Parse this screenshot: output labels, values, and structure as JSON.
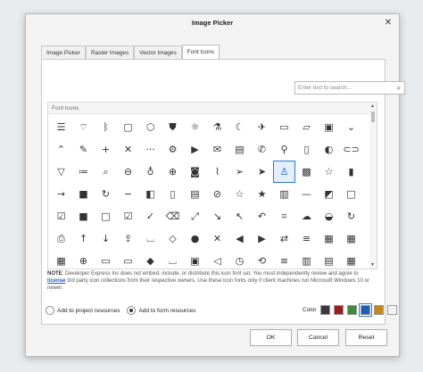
{
  "dialog": {
    "title": "Image Picker",
    "close_glyph": "✕"
  },
  "tabs": [
    {
      "label": "Image Picker",
      "active": false
    },
    {
      "label": "Raster Images",
      "active": false
    },
    {
      "label": "Vector Images",
      "active": false
    },
    {
      "label": "Font Icons",
      "active": true
    }
  ],
  "search": {
    "placeholder": "Enter text to search...",
    "icon": "search-icon"
  },
  "grid": {
    "group_header": "Font Icons",
    "selected_index": 38,
    "icons": [
      {
        "name": "hamburger-icon",
        "glyph": "☰"
      },
      {
        "name": "wifi-icon",
        "glyph": "⌔"
      },
      {
        "name": "bluetooth-icon",
        "glyph": "ᛒ"
      },
      {
        "name": "chat-icon",
        "glyph": "▢"
      },
      {
        "name": "cube-icon",
        "glyph": "⬡"
      },
      {
        "name": "shield-icon",
        "glyph": "⛊"
      },
      {
        "name": "sun-icon",
        "glyph": "☼"
      },
      {
        "name": "flask-icon",
        "glyph": "⚗"
      },
      {
        "name": "moon-icon",
        "glyph": "☾"
      },
      {
        "name": "airplane-icon",
        "glyph": "✈"
      },
      {
        "name": "keyboard-icon",
        "glyph": "▭"
      },
      {
        "name": "note-icon",
        "glyph": "▱"
      },
      {
        "name": "picture-icon",
        "glyph": "▣"
      },
      {
        "name": "chevron-down-icon",
        "glyph": "⌄"
      },
      {
        "name": "chevron-up-icon",
        "glyph": "⌃"
      },
      {
        "name": "pencil-icon",
        "glyph": "✎"
      },
      {
        "name": "plus-icon",
        "glyph": "+"
      },
      {
        "name": "close-icon",
        "glyph": "✕"
      },
      {
        "name": "more-icon",
        "glyph": "···"
      },
      {
        "name": "gear-icon",
        "glyph": "⚙"
      },
      {
        "name": "video-icon",
        "glyph": "▶"
      },
      {
        "name": "mail-icon",
        "glyph": "✉"
      },
      {
        "name": "save-icon",
        "glyph": "▤"
      },
      {
        "name": "phone-icon",
        "glyph": "✆"
      },
      {
        "name": "pin-icon",
        "glyph": "⚲"
      },
      {
        "name": "battery-icon",
        "glyph": "▯"
      },
      {
        "name": "toggle-icon",
        "glyph": "◐"
      },
      {
        "name": "link-icon",
        "glyph": "⊂⊃"
      },
      {
        "name": "filter-icon",
        "glyph": "▽"
      },
      {
        "name": "list-icon",
        "glyph": "≔"
      },
      {
        "name": "search-icon",
        "glyph": "⌕"
      },
      {
        "name": "zoom-out-icon",
        "glyph": "⊖"
      },
      {
        "name": "mic-icon",
        "glyph": "♁"
      },
      {
        "name": "zoom-in-icon",
        "glyph": "⊕"
      },
      {
        "name": "camera-icon",
        "glyph": "◙"
      },
      {
        "name": "paperclip-icon",
        "glyph": "⌇"
      },
      {
        "name": "send-icon",
        "glyph": "➢"
      },
      {
        "name": "send-filled-icon",
        "glyph": "➤"
      },
      {
        "name": "walk-icon",
        "glyph": "♙"
      },
      {
        "name": "image-icon",
        "glyph": "▩"
      },
      {
        "name": "star-note-icon",
        "glyph": "☆"
      },
      {
        "name": "document-icon",
        "glyph": "▮"
      },
      {
        "name": "arrow-right-icon",
        "glyph": "→"
      },
      {
        "name": "square-fill-icon",
        "glyph": "■"
      },
      {
        "name": "refresh-icon",
        "glyph": "↻"
      },
      {
        "name": "minus-icon",
        "glyph": "−"
      },
      {
        "name": "square-split-icon",
        "glyph": "◧"
      },
      {
        "name": "file-icon",
        "glyph": "▯"
      },
      {
        "name": "file-text-icon",
        "glyph": "▤"
      },
      {
        "name": "ban-icon",
        "glyph": "⊘"
      },
      {
        "name": "star-icon",
        "glyph": "☆"
      },
      {
        "name": "star-filled-icon",
        "glyph": "★"
      },
      {
        "name": "book-icon",
        "glyph": "▥"
      },
      {
        "name": "dash-icon",
        "glyph": "—"
      },
      {
        "name": "square-half-icon",
        "glyph": "◩"
      },
      {
        "name": "square-outline-icon",
        "glyph": "□"
      },
      {
        "name": "checkbox-icon",
        "glyph": "☑"
      },
      {
        "name": "square-dark-icon",
        "glyph": "■"
      },
      {
        "name": "square-outline2-icon",
        "glyph": "□"
      },
      {
        "name": "checkbox-filled-icon",
        "glyph": "☑"
      },
      {
        "name": "check-icon",
        "glyph": "✓"
      },
      {
        "name": "trash-icon",
        "glyph": "⌫"
      },
      {
        "name": "expand-icon",
        "glyph": "⤢"
      },
      {
        "name": "arrow-down-right-icon",
        "glyph": "↘"
      },
      {
        "name": "arrow-up-left-icon",
        "glyph": "↖"
      },
      {
        "name": "undo-icon",
        "glyph": "↶"
      },
      {
        "name": "crop-icon",
        "glyph": "⌗"
      },
      {
        "name": "cloud-icon",
        "glyph": "☁"
      },
      {
        "name": "square-bottom-icon",
        "glyph": "◒"
      },
      {
        "name": "redo-icon",
        "glyph": "↻"
      },
      {
        "name": "printer-icon",
        "glyph": "⎙"
      },
      {
        "name": "arrow-up-icon",
        "glyph": "↑"
      },
      {
        "name": "arrow-down-icon",
        "glyph": "↓"
      },
      {
        "name": "upload-icon",
        "glyph": "⇪"
      },
      {
        "name": "bucket-icon",
        "glyph": "⌴"
      },
      {
        "name": "eraser-icon",
        "glyph": "◇"
      },
      {
        "name": "mouse-icon",
        "glyph": "●"
      },
      {
        "name": "mute-icon",
        "glyph": "✕"
      },
      {
        "name": "back-circle-icon",
        "glyph": "◀"
      },
      {
        "name": "forward-circle-icon",
        "glyph": "▶"
      },
      {
        "name": "link2-icon",
        "glyph": "⇄"
      },
      {
        "name": "heading-icon",
        "glyph": "≡"
      },
      {
        "name": "table-icon",
        "glyph": "▦"
      },
      {
        "name": "grid-icon",
        "glyph": "▦"
      },
      {
        "name": "calendar-icon",
        "glyph": "▦"
      },
      {
        "name": "target-icon",
        "glyph": "⊕"
      },
      {
        "name": "id-card-icon",
        "glyph": "▭"
      },
      {
        "name": "box-icon",
        "glyph": "▭"
      },
      {
        "name": "eraser2-icon",
        "glyph": "◆"
      },
      {
        "name": "cup-icon",
        "glyph": "⌴"
      },
      {
        "name": "lock-icon",
        "glyph": "▣"
      },
      {
        "name": "sound-icon",
        "glyph": "◁"
      },
      {
        "name": "clock-icon",
        "glyph": "◷"
      },
      {
        "name": "sync-icon",
        "glyph": "⟲"
      },
      {
        "name": "align-icon",
        "glyph": "≡"
      },
      {
        "name": "columns-icon",
        "glyph": "▥"
      },
      {
        "name": "rows-icon",
        "glyph": "▤"
      },
      {
        "name": "tile-icon",
        "glyph": "▦"
      }
    ]
  },
  "note": {
    "bold": "NOTE",
    "text1": ": Developer Express Inc does not embed, include, or distribute this icon font set. You must independently review and agree to ",
    "link": "license",
    "text2": " 3rd party icon collections from their respective owners. Use these icon fonts only if client machines run Microsoft Windows 10 or newer."
  },
  "resources": {
    "project_label": "Add to project resources",
    "form_label": "Add to form resources",
    "selected": "form"
  },
  "color": {
    "label": "Color",
    "swatches": [
      "#3a3a3a",
      "#a11d1d",
      "#3f8a3c",
      "#1b5fb0",
      "#c7861b",
      "#f3f3f3"
    ],
    "selected_index": 3
  },
  "buttons": {
    "ok": "OK",
    "cancel": "Cancel",
    "reset": "Reset"
  }
}
